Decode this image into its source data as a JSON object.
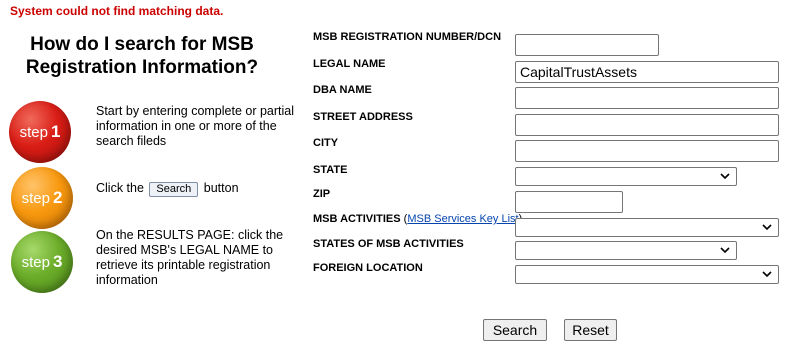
{
  "error_message": "System could not find matching data.",
  "heading": "How do I search for MSB Registration Information?",
  "steps": [
    {
      "badge_word": "step",
      "badge_num": "1",
      "color": "#d91d16",
      "text": "Start by entering complete or partial information in one or more of the search fileds"
    },
    {
      "badge_word": "step",
      "badge_num": "2",
      "color": "#f8990f",
      "text_before": "Click the",
      "inline_button": "Search",
      "text_after": "button"
    },
    {
      "badge_word": "step",
      "badge_num": "3",
      "color": "#6cad2a",
      "text": "On the RESULTS PAGE: click the desired MSB's LEGAL NAME to retrieve its printable registration information"
    }
  ],
  "form": {
    "registration_number": {
      "label": "MSB REGISTRATION NUMBER/DCN",
      "value": ""
    },
    "legal_name": {
      "label": "LEGAL NAME",
      "value": "CapitalTrustAssets"
    },
    "dba_name": {
      "label": "DBA NAME",
      "value": ""
    },
    "street_address": {
      "label": "STREET ADDRESS",
      "value": ""
    },
    "city": {
      "label": "CITY",
      "value": ""
    },
    "state": {
      "label": "STATE",
      "selected": ""
    },
    "zip": {
      "label": "ZIP",
      "value": ""
    },
    "msb_activities": {
      "label": "MSB ACTIVITIES",
      "link": "MSB Services Key List",
      "selected": ""
    },
    "states_of_activities": {
      "label": "STATES OF MSB ACTIVITIES",
      "selected": ""
    },
    "foreign_location": {
      "label": "FOREIGN LOCATION",
      "selected": ""
    }
  },
  "buttons": {
    "search": "Search",
    "reset": "Reset"
  }
}
